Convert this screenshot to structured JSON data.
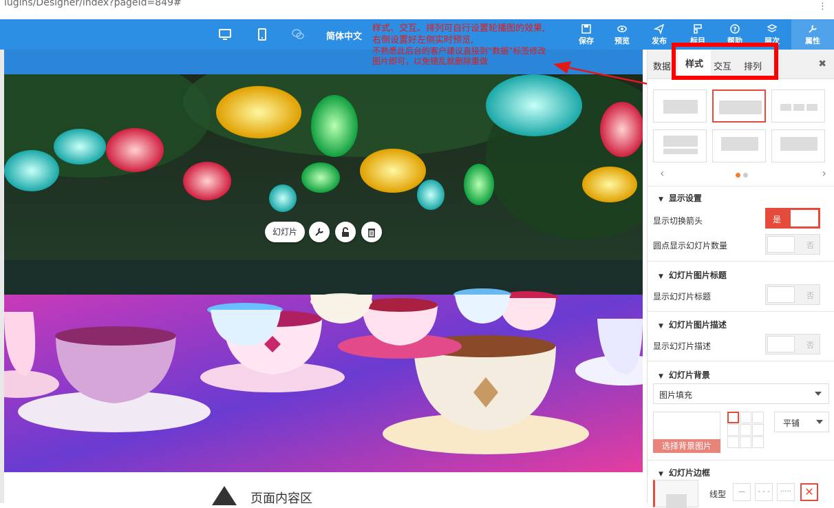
{
  "browser": {
    "url": "lugins/Designer/index?pageId=849#"
  },
  "toolbar": {
    "language": "简体中文",
    "save": "保存",
    "preview": "预览",
    "publish": "发布",
    "template": "标目",
    "help": "帮助",
    "layers": "层次",
    "properties": "属性"
  },
  "annotation": {
    "line1": "样式、交互、排列可自行设置轮播图的效果,",
    "line2": "右侧设置好左侧实时预览,",
    "line3": "不熟悉此后台的客户建议直接到“数据”标签修改",
    "line4": "图片即可，以免错乱就删除重做"
  },
  "slide": {
    "label": "幻灯片"
  },
  "page_content": {
    "label": "页面内容区"
  },
  "panel": {
    "tabs": [
      "数据",
      "样式",
      "交互",
      "排列"
    ],
    "active_tab": "样式",
    "sections": {
      "display": {
        "title": "显示设置",
        "show_arrows_label": "显示切换箭头",
        "show_arrows_value": "是",
        "show_count_label": "圆点显示幻灯片数量",
        "show_count_value": "否"
      },
      "title": {
        "title": "幻灯片图片标题",
        "show_title_label": "显示幻灯片标题",
        "show_title_value": "否"
      },
      "desc": {
        "title": "幻灯片图片描述",
        "show_desc_label": "显示幻灯片描述",
        "show_desc_value": "否"
      },
      "background": {
        "title": "幻灯片背景",
        "fill_mode": "图片填充",
        "choose_image": "选择背景图片",
        "repeat": "平铺"
      },
      "border": {
        "title": "幻灯片边框",
        "line_type_label": "线型"
      }
    }
  },
  "colors": {
    "toolbar_bg": "#2d8fe4",
    "accent_red": "#e64a3a",
    "annotation_red": "#e21919"
  }
}
